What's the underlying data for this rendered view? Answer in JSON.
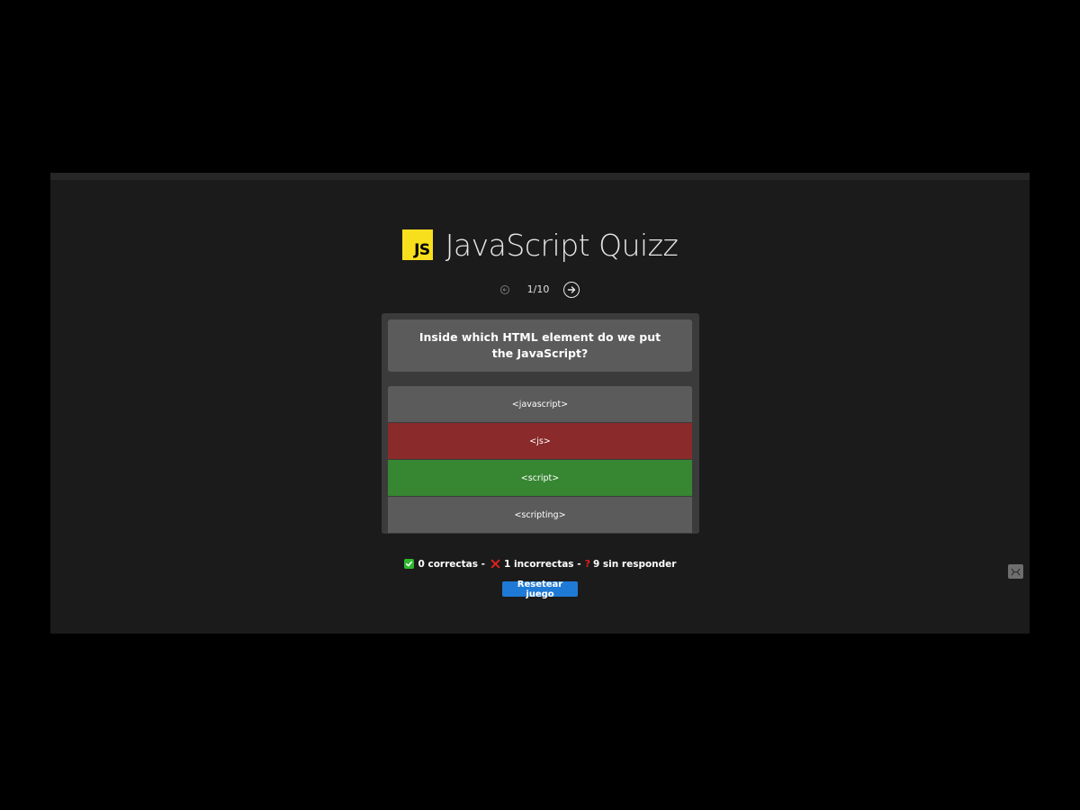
{
  "app": {
    "logo_text": "JS",
    "title": "JavaScript Quizz",
    "accent_color": "#f7df1e"
  },
  "nav": {
    "counter": "1/10",
    "prev_icon": "circle-arrow-left-icon",
    "next_icon": "circle-arrow-right-icon"
  },
  "question": {
    "text": "Inside which HTML element do we put the JavaScript?",
    "answers": [
      {
        "label": "<javascript>",
        "state": "neutral"
      },
      {
        "label": "<js>",
        "state": "incorrect",
        "color": "#8a2a2a"
      },
      {
        "label": "<script>",
        "state": "correct",
        "color": "#368632"
      },
      {
        "label": "<scripting>",
        "state": "neutral"
      }
    ]
  },
  "score": {
    "correct_text": "0 correctas -",
    "incorrect_text": "1 incorrectas -",
    "unanswered_text": "9 sin responder",
    "correct_icon": "check-icon",
    "incorrect_icon": "cross-icon",
    "unanswered_icon": "question-mark-icon"
  },
  "actions": {
    "reset_label": "Resetear juego",
    "reset_color": "#1f7ad6"
  }
}
